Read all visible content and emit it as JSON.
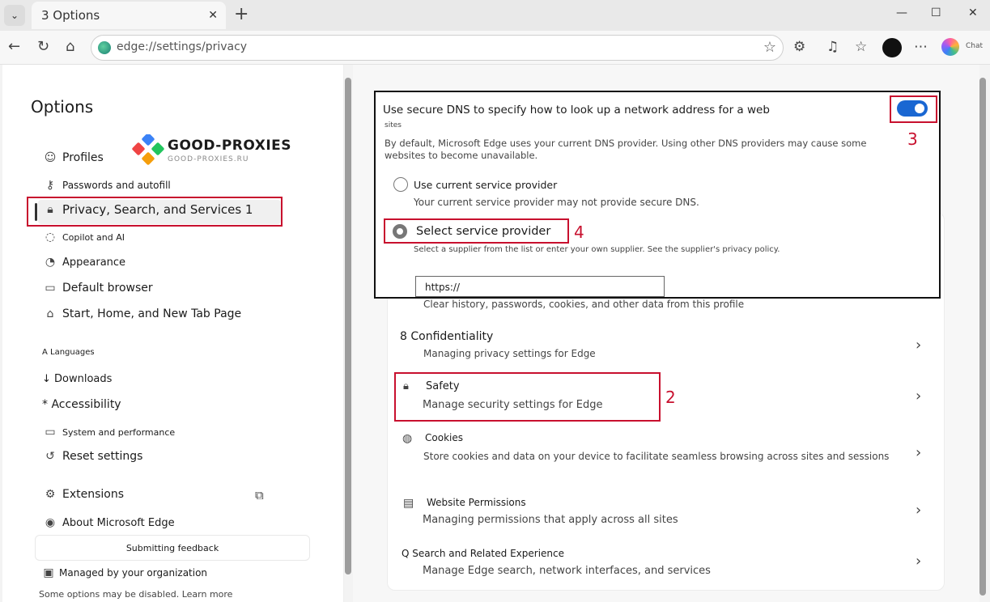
{
  "browser": {
    "tab_title": "3 Options",
    "tab_close": "✕",
    "new_tab": "+",
    "address": "edge://settings/privacy",
    "chat_label": "Chat",
    "window_controls": [
      "—",
      "☐",
      "✕"
    ]
  },
  "logo": {
    "main": "GOOD-PROXIES",
    "sub": "GOOD-PROXIES.RU"
  },
  "sidebar": {
    "title": "Options",
    "items": [
      {
        "label": "Profiles",
        "icon": "profile-icon"
      },
      {
        "label": "Passwords and autofill",
        "icon": "key-icon"
      },
      {
        "label": "Privacy, Search, and Services 1",
        "icon": "lock-icon"
      },
      {
        "label": "Copilot and AI",
        "icon": "copilot-icon"
      },
      {
        "label": "Appearance",
        "icon": "palette-icon"
      },
      {
        "label": "Default browser",
        "icon": "browser-icon"
      },
      {
        "label": "Start, Home, and New Tab Page",
        "icon": "home-icon"
      },
      {
        "label": "A Languages",
        "icon": ""
      },
      {
        "label": "↓ Downloads",
        "icon": ""
      },
      {
        "label": "* Accessibility",
        "icon": ""
      },
      {
        "label": "System and performance",
        "icon": "laptop-icon"
      },
      {
        "label": "Reset settings",
        "icon": "reset-icon"
      },
      {
        "label": "Extensions",
        "icon": "extensions-icon"
      },
      {
        "label": "About Microsoft Edge",
        "icon": "edge-icon"
      }
    ],
    "feedback": "Submitting feedback",
    "managed": "Managed by your organization",
    "disabled_note": "Some options may be disabled. Learn more"
  },
  "dns": {
    "title": "Use secure DNS to specify how to look up a network address for a web",
    "title_cont": "sites",
    "desc_line1": "By default, Microsoft Edge uses your current DNS provider. Using other DNS providers may cause some",
    "desc_line2": "websites to become unavailable.",
    "option1_label": "Use current service provider",
    "option1_desc": "Your current service provider may not provide secure DNS.",
    "option2_label": "Select service provider",
    "option2_desc": "Select a supplier from the list or enter your own supplier. See the supplier's privacy policy.",
    "input_value": "https://",
    "toggle_on": true
  },
  "privacy_rows": [
    {
      "title": "",
      "desc": "Clear history, passwords, cookies, and other data from this profile"
    },
    {
      "title": "8 Confidentiality",
      "desc": "Managing privacy settings for Edge"
    },
    {
      "title": "Safety",
      "desc": "Manage security settings for Edge"
    },
    {
      "title": "Cookies",
      "desc": "Store cookies and data on your device to facilitate seamless browsing across sites and sessions"
    },
    {
      "title": "Website Permissions",
      "desc": "Managing permissions that apply across all sites"
    },
    {
      "title": "Q Search and Related Experience",
      "desc": "Manage Edge search, network interfaces, and services"
    }
  ],
  "annotations": {
    "n1": "",
    "n2": "2",
    "n3": "3",
    "n4": "4"
  },
  "colors": {
    "annotation_red": "#c8102e",
    "toggle_blue": "#1a67d2"
  }
}
